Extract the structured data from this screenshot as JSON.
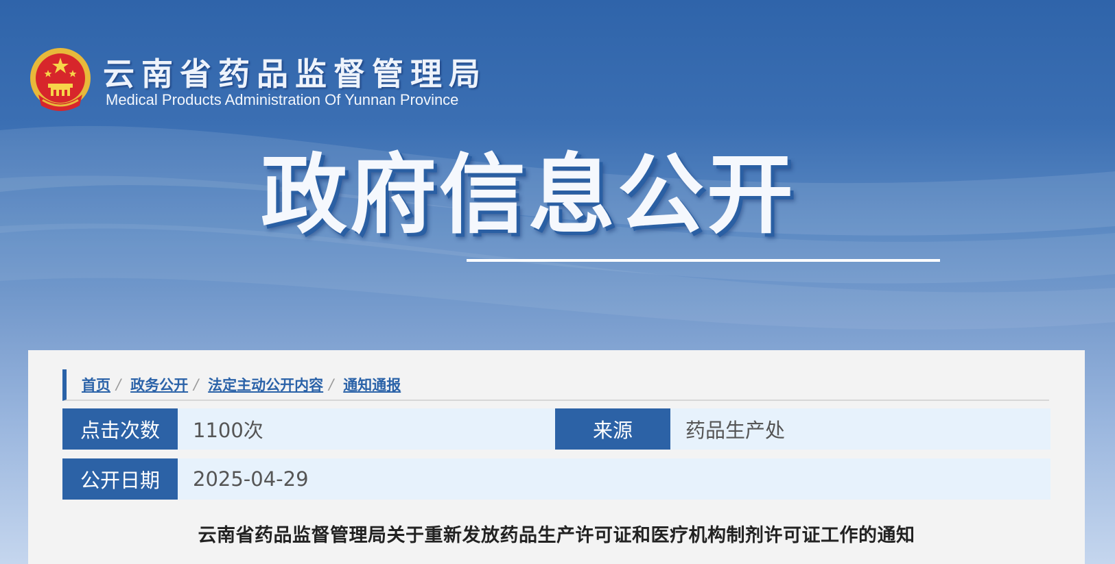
{
  "header": {
    "site_title": "云南省药品监督管理局",
    "site_subtitle": "Medical Products Administration Of Yunnan Province",
    "banner_heading": "政府信息公开"
  },
  "breadcrumb": [
    {
      "label": "首页"
    },
    {
      "label": "政务公开"
    },
    {
      "label": "法定主动公开内容"
    },
    {
      "label": "通知通报"
    }
  ],
  "breadcrumb_separator": "/",
  "meta": {
    "clicks_label": "点击次数",
    "clicks_value": "1100次",
    "source_label": "来源",
    "source_value": "药品生产处",
    "date_label": "公开日期",
    "date_value": "2025-04-29"
  },
  "article": {
    "title": "云南省药品监督管理局关于重新发放药品生产许可证和医疗机构制剂许可证工作的通知"
  },
  "colors": {
    "accent_blue": "#2c62a6",
    "meta_row_bg": "#e7f2fc",
    "panel_bg": "#f3f3f3"
  }
}
